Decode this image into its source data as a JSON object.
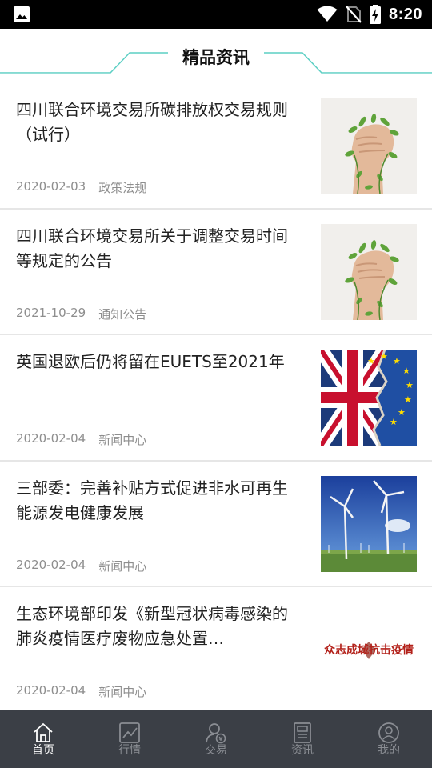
{
  "status_bar": {
    "time": "8:20",
    "icons": [
      "image-icon",
      "wifi-icon",
      "no-sim-icon",
      "battery-charging-icon"
    ]
  },
  "section": {
    "title": "精品资讯",
    "accent_color": "#5ccfc4"
  },
  "news": [
    {
      "title": "四川联合环境交易所碳排放权交易规则（试行）",
      "date": "2020-02-03",
      "category": "政策法规",
      "thumb": "green-fist-image"
    },
    {
      "title": "四川联合环境交易所关于调整交易时间等规定的公告",
      "date": "2021-10-29",
      "category": "通知公告",
      "thumb": "green-fist-image"
    },
    {
      "title": "英国退欧后仍将留在EUETS至2021年",
      "date": "2020-02-04",
      "category": "新闻中心",
      "thumb": "uk-eu-flag-image"
    },
    {
      "title": "三部委：完善补贴方式促进非水可再生能源发电健康发展",
      "date": "2020-02-04",
      "category": "新闻中心",
      "thumb": "wind-turbine-image"
    },
    {
      "title": "生态环境部印发《新型冠状病毒感染的肺炎疫情医疗废物应急处置…",
      "date": "2020-02-04",
      "category": "新闻中心",
      "thumb": "epidemic-banner-image",
      "thumb_text": "众志成城抗击疫情"
    }
  ],
  "bottom_nav": [
    {
      "label": "首页",
      "icon": "home-icon",
      "active": true
    },
    {
      "label": "行情",
      "icon": "chart-icon",
      "active": false
    },
    {
      "label": "交易",
      "icon": "trade-icon",
      "active": false
    },
    {
      "label": "资讯",
      "icon": "news-icon",
      "active": false
    },
    {
      "label": "我的",
      "icon": "user-icon",
      "active": false
    }
  ]
}
